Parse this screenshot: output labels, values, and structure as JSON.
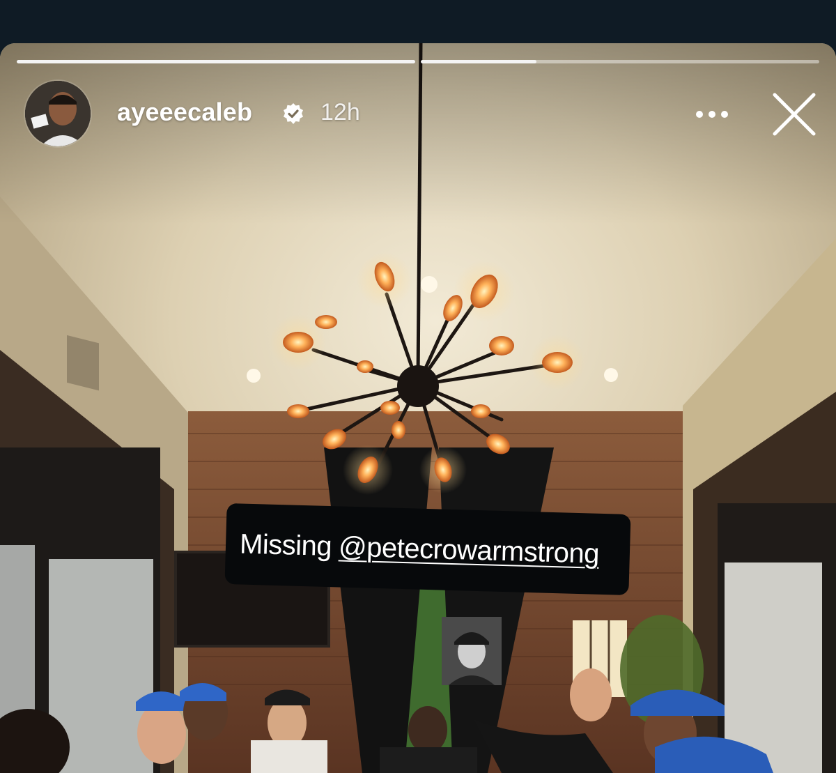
{
  "story": {
    "username": "ayeeecaleb",
    "verified": true,
    "timestamp": "12h",
    "progress": [
      1.0,
      0.29
    ],
    "caption": {
      "text": "Missing",
      "mention": "@petecrowarmstrong"
    }
  },
  "icons": {
    "verified": "verified-badge-icon",
    "more": "more-horizontal-icon",
    "close": "close-icon"
  },
  "colors": {
    "background": "#0f1b25",
    "caption_bg": "#07090b",
    "text": "#ffffff"
  }
}
